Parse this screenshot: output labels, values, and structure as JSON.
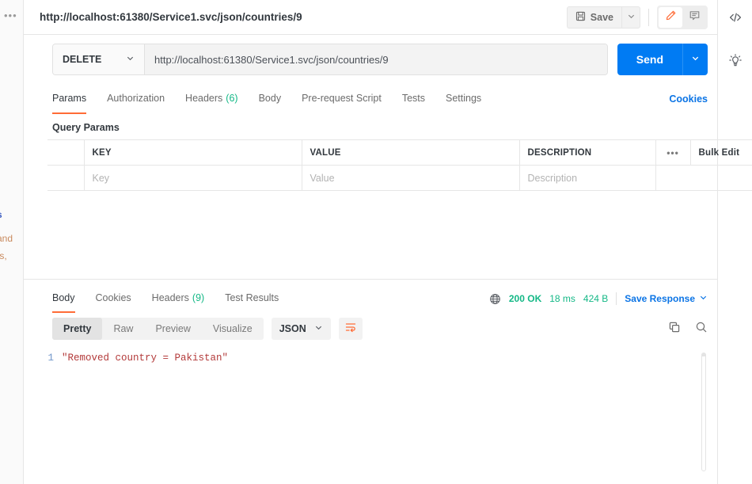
{
  "topbar": {
    "request_title": "http://localhost:61380/Service1.svc/json/countries/9",
    "save_label": "Save",
    "save_icon": "floppy-disk-icon",
    "save_caret_icon": "chevron-down-icon",
    "edit_icon": "pencil-icon",
    "comment_icon": "comment-icon"
  },
  "request": {
    "method": "DELETE",
    "method_caret_icon": "chevron-down-icon",
    "url": "http://localhost:61380/Service1.svc/json/countries/9",
    "send_label": "Send",
    "send_caret_icon": "chevron-down-icon"
  },
  "request_tabs": {
    "items": [
      {
        "label": "Params",
        "count": "",
        "active": true
      },
      {
        "label": "Authorization",
        "count": "",
        "active": false
      },
      {
        "label": "Headers",
        "count": "(6)",
        "active": false
      },
      {
        "label": "Body",
        "count": "",
        "active": false
      },
      {
        "label": "Pre-request Script",
        "count": "",
        "active": false
      },
      {
        "label": "Tests",
        "count": "",
        "active": false
      },
      {
        "label": "Settings",
        "count": "",
        "active": false
      }
    ],
    "cookies_link": "Cookies"
  },
  "query_params": {
    "section_label": "Query Params",
    "headers": {
      "key": "KEY",
      "value": "VALUE",
      "description": "DESCRIPTION",
      "options_icon": "ellipsis-icon",
      "bulk_edit": "Bulk Edit"
    },
    "rows": [
      {
        "key": "Key",
        "value": "Value",
        "description": "Description"
      }
    ]
  },
  "response_tabs": {
    "items": [
      {
        "label": "Body",
        "count": "",
        "active": true
      },
      {
        "label": "Cookies",
        "count": "",
        "active": false
      },
      {
        "label": "Headers",
        "count": "(9)",
        "active": false
      },
      {
        "label": "Test Results",
        "count": "",
        "active": false
      }
    ]
  },
  "response_meta": {
    "globe_icon": "globe-icon",
    "status": "200 OK",
    "time": "18 ms",
    "size": "424 B",
    "save_response": "Save Response",
    "save_response_caret_icon": "chevron-down-icon"
  },
  "response_toolbar": {
    "views": [
      {
        "label": "Pretty",
        "active": true
      },
      {
        "label": "Raw",
        "active": false
      },
      {
        "label": "Preview",
        "active": false
      },
      {
        "label": "Visualize",
        "active": false
      }
    ],
    "format": "JSON",
    "format_caret_icon": "chevron-down-icon",
    "wrap_icon": "word-wrap-icon",
    "copy_icon": "copy-icon",
    "search_icon": "search-icon"
  },
  "response_body": {
    "lines": [
      {
        "number": "1",
        "text": "\"Removed country = Pakistan\""
      }
    ]
  },
  "left_rail": {
    "menu_icon": "ellipsis-icon",
    "fragments": [
      "s",
      "and",
      "ts,"
    ]
  },
  "right_rail": {
    "items": [
      {
        "icon": "code-icon"
      },
      {
        "icon": "lightbulb-icon"
      }
    ]
  },
  "colors": {
    "accent_orange": "#ff6c37",
    "link_blue": "#0b74e5",
    "send_blue": "#007bf3",
    "success_green": "#14b886",
    "json_string": "#b33a3a"
  }
}
